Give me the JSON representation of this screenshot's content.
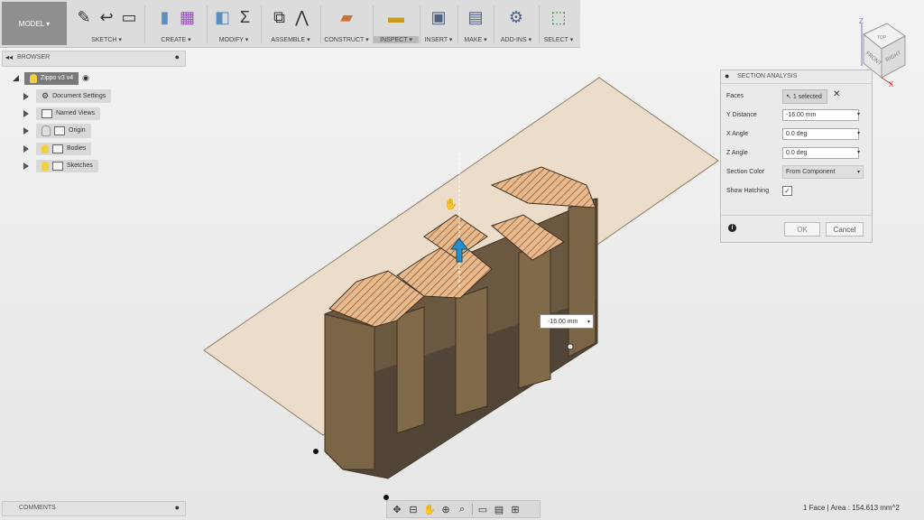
{
  "toolbar": {
    "model_label": "MODEL ▾",
    "groups": [
      {
        "label": "SKETCH ▾",
        "icons": [
          "sketch-icon",
          "line-icon",
          "rectangle-icon"
        ]
      },
      {
        "label": "CREATE ▾",
        "icons": [
          "extrude-icon",
          "form-icon"
        ]
      },
      {
        "label": "MODIFY ▾",
        "icons": [
          "press-pull-icon",
          "sum-icon"
        ]
      },
      {
        "label": "ASSEMBLE ▾",
        "icons": [
          "new-component-icon",
          "joint-icon"
        ]
      },
      {
        "label": "CONSTRUCT ▾",
        "icons": [
          "plane-icon"
        ]
      },
      {
        "label": "INSPECT ▾",
        "icons": [
          "measure-icon"
        ]
      },
      {
        "label": "INSERT ▾",
        "icons": [
          "insert-image-icon"
        ]
      },
      {
        "label": "MAKE ▾",
        "icons": [
          "print-icon"
        ]
      },
      {
        "label": "ADD-INS ▾",
        "icons": [
          "scripts-icon"
        ]
      },
      {
        "label": "SELECT ▾",
        "icons": [
          "select-icon"
        ]
      }
    ]
  },
  "browser": {
    "title": "BROWSER",
    "root": "Zippo v3 v4",
    "items": [
      {
        "label": "Document Settings",
        "icon": "gear-icon"
      },
      {
        "label": "Named Views",
        "icon": "folder-icon"
      },
      {
        "label": "Origin",
        "icon": "folder-icon"
      },
      {
        "label": "Bodies",
        "icon": "folder-icon"
      },
      {
        "label": "Sketches",
        "icon": "folder-icon"
      }
    ]
  },
  "comments": {
    "title": "COMMENTS"
  },
  "dialog": {
    "title": "SECTION ANALYSIS",
    "faces_label": "Faces",
    "faces_value": "1 selected",
    "y_distance_label": "Y Distance",
    "y_distance_value": "-16.00 mm",
    "x_angle_label": "X Angle",
    "x_angle_value": "0.0 deg",
    "z_angle_label": "Z Angle",
    "z_angle_value": "0.0 deg",
    "section_color_label": "Section Color",
    "section_color_value": "From Component",
    "show_hatching_label": "Show Hatching",
    "ok_label": "OK",
    "cancel_label": "Cancel"
  },
  "viewport": {
    "dimension_value": "-16.00 mm",
    "viewcube": {
      "top": "TOP",
      "front": "FRONT",
      "right": "RIGHT",
      "z": "Z",
      "x": "X"
    }
  },
  "status": {
    "text": "1 Face | Area : 154.613 mm^2"
  }
}
